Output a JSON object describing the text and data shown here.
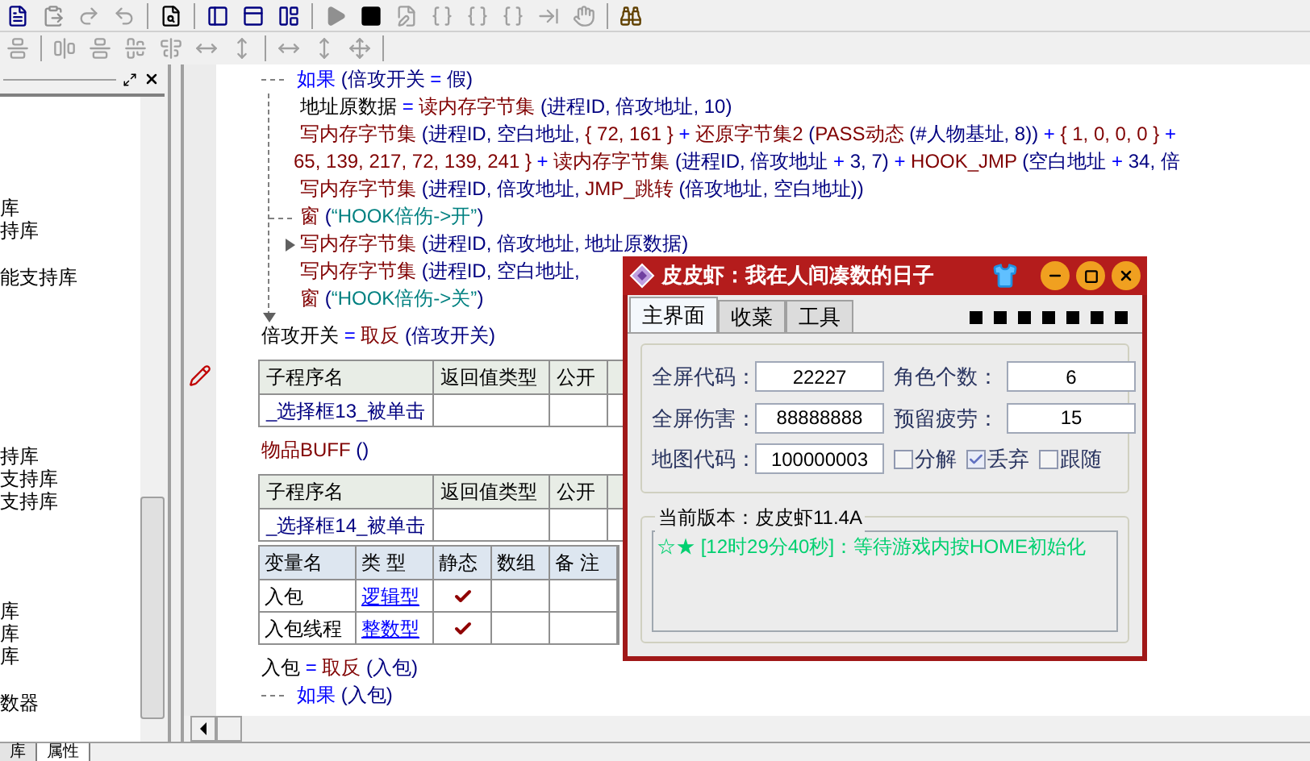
{
  "left_panel": {
    "groups": [
      [
        "库",
        "持库"
      ],
      [
        "能支持库"
      ],
      [
        "持库",
        "支持库",
        "支持库"
      ],
      [
        "库",
        "库",
        "库"
      ],
      [
        "数器"
      ]
    ]
  },
  "left_tabs": [
    {
      "label": "库",
      "selected": false
    },
    {
      "label": "属性",
      "selected": true
    }
  ],
  "code": [
    {
      "kind": "if",
      "tokens": [
        {
          "kind": "kw",
          "text": "如果"
        },
        {
          "kind": "p",
          "text": " (倍攻开关 "
        },
        {
          "kind": "op",
          "text": "="
        },
        {
          "kind": "p",
          "text": " 假)"
        }
      ],
      "children": [
        {
          "kind": "line",
          "tokens": [
            {
              "kind": "v",
              "text": "地址原数据 "
            },
            {
              "kind": "op",
              "text": "="
            },
            {
              "kind": "cmd",
              "text": " 读内存字节集"
            },
            {
              "kind": "p",
              "text": " (进程ID, 倍攻地址, 10)"
            }
          ]
        },
        {
          "kind": "line",
          "tokens": [
            {
              "kind": "cmd",
              "text": "写内存字节集"
            },
            {
              "kind": "p",
              "text": " (进程ID, 空白地址, "
            },
            {
              "kind": "c",
              "text": "{ 72, 161 }"
            },
            {
              "kind": "op",
              "text": " + "
            },
            {
              "kind": "cmd",
              "text": "还原字节集2"
            },
            {
              "kind": "p",
              "text": " ("
            },
            {
              "kind": "cmd",
              "text": "PASS动态"
            },
            {
              "kind": "p",
              "text": " (#人物基址, 8)) "
            },
            {
              "kind": "op",
              "text": "+ "
            },
            {
              "kind": "c",
              "text": "{ 1, 0, 0, 0 }"
            },
            {
              "kind": "op",
              "text": " +"
            }
          ]
        },
        {
          "kind": "wrap",
          "tokens": [
            {
              "kind": "c",
              "text": "65, 139, 217, 72, 139, 241 }"
            },
            {
              "kind": "op",
              "text": " + "
            },
            {
              "kind": "cmd",
              "text": "读内存字节集"
            },
            {
              "kind": "p",
              "text": " (进程ID, 倍攻地址 "
            },
            {
              "kind": "op",
              "text": "+"
            },
            {
              "kind": "p",
              "text": " 3, 7) "
            },
            {
              "kind": "op",
              "text": "+ "
            },
            {
              "kind": "cmd",
              "text": "HOOK_JMP"
            },
            {
              "kind": "p",
              "text": " (空白地址 "
            },
            {
              "kind": "op",
              "text": "+"
            },
            {
              "kind": "p",
              "text": " 34, 倍"
            }
          ]
        },
        {
          "kind": "line",
          "tokens": [
            {
              "kind": "cmd",
              "text": "写内存字节集"
            },
            {
              "kind": "p",
              "text": " (进程ID, 倍攻地址, "
            },
            {
              "kind": "cmd",
              "text": "JMP_跳转"
            },
            {
              "kind": "p",
              "text": " (倍攻地址, 空白地址))"
            }
          ]
        },
        {
          "kind": "branch",
          "tokens": [
            {
              "kind": "cmd",
              "text": "窗"
            },
            {
              "kind": "p",
              "text": " ("
            },
            {
              "kind": "s",
              "text": "“HOOK倍伤->开”"
            },
            {
              "kind": "p",
              "text": ")"
            }
          ]
        },
        {
          "kind": "arrow",
          "tokens": [
            {
              "kind": "cmd",
              "text": "写内存字节集"
            },
            {
              "kind": "p",
              "text": " (进程ID, 倍攻地址, 地址原数据)"
            }
          ]
        },
        {
          "kind": "line",
          "tokens": [
            {
              "kind": "cmd",
              "text": "写内存字节集"
            },
            {
              "kind": "p",
              "text": " (进程ID, 空白地址, "
            }
          ]
        },
        {
          "kind": "line",
          "tokens": [
            {
              "kind": "cmd",
              "text": "窗"
            },
            {
              "kind": "p",
              "text": " ("
            },
            {
              "kind": "s",
              "text": "“HOOK倍伤->关”"
            },
            {
              "kind": "p",
              "text": ")"
            }
          ]
        }
      ]
    },
    {
      "kind": "line",
      "tokens": [
        {
          "kind": "v",
          "text": "倍攻开关 "
        },
        {
          "kind": "op",
          "text": "="
        },
        {
          "kind": "cmd",
          "text": " 取反"
        },
        {
          "kind": "p",
          "text": " (倍攻开关)"
        }
      ]
    },
    {
      "kind": "sub",
      "columns": [
        "子程序名",
        "返回值类型",
        "公开"
      ],
      "name": "_选择框13_被单击"
    },
    {
      "kind": "line",
      "tokens": [
        {
          "kind": "cmd",
          "text": "物品BUFF"
        },
        {
          "kind": "p",
          "text": " ()"
        }
      ]
    },
    {
      "kind": "sub",
      "columns": [
        "子程序名",
        "返回值类型",
        "公开"
      ],
      "name": "_选择框14_被单击"
    },
    {
      "kind": "vars",
      "columns": [
        "变量名",
        "类 型",
        "静态",
        "数组",
        "备 注"
      ],
      "rows": [
        {
          "name": "入包",
          "type": "逻辑型",
          "static": true,
          "array": false
        },
        {
          "name": "入包线程",
          "type": "整数型",
          "static": true,
          "array": false
        }
      ]
    },
    {
      "kind": "line",
      "tokens": [
        {
          "kind": "v",
          "text": "入包 "
        },
        {
          "kind": "op",
          "text": "="
        },
        {
          "kind": "cmd",
          "text": " 取反"
        },
        {
          "kind": "p",
          "text": " (入包)"
        }
      ]
    },
    {
      "kind": "if",
      "tokens": [
        {
          "kind": "kw",
          "text": "如果"
        },
        {
          "kind": "p",
          "text": " (入包)"
        }
      ]
    }
  ],
  "dialog": {
    "title": "皮皮虾：我在人间凑数的日子",
    "tabs": [
      {
        "label": "主界面",
        "selected": true
      },
      {
        "label": "收菜",
        "selected": false
      },
      {
        "label": "工具",
        "selected": false
      }
    ],
    "fields": [
      {
        "label": "全屏代码：",
        "value": "22227"
      },
      {
        "label": "角色个数：",
        "value": "6"
      },
      {
        "label": "全屏伤害：",
        "value": "88888888"
      },
      {
        "label": "预留疲劳：",
        "value": "15"
      },
      {
        "label": "地图代码：",
        "value": "100000003"
      }
    ],
    "checkboxes": [
      {
        "label": "分解",
        "checked": false
      },
      {
        "label": "丢弃",
        "checked": true
      },
      {
        "label": "跟随",
        "checked": false
      }
    ],
    "version": "当前版本：皮皮虾11.4A",
    "log": "☆★ [12时29分40秒]：等待游戏内按HOME初始化"
  }
}
